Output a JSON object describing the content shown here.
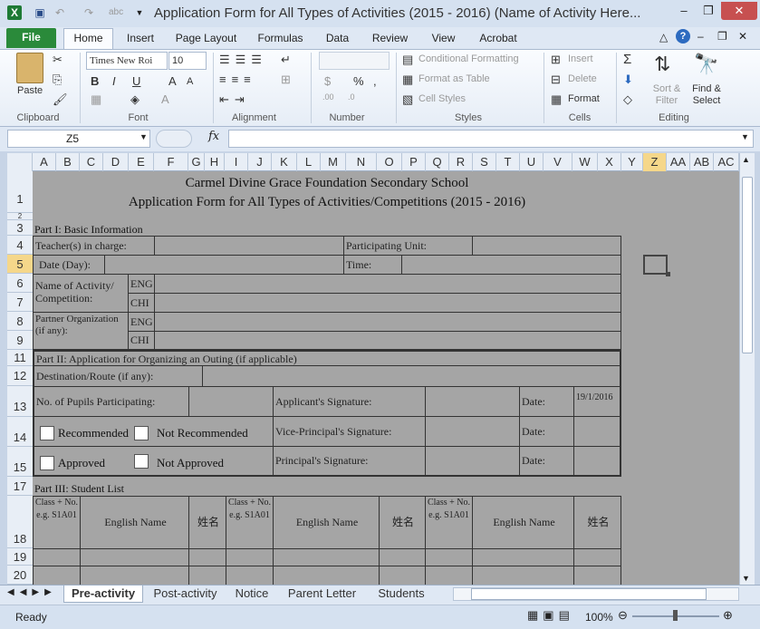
{
  "window": {
    "title": "Application Form for All Types of Activities (2015 - 2016) (Name of Activity Here...",
    "minimize": "–",
    "restore": "❐",
    "close": "✕"
  },
  "ribbon_tabs": [
    "File",
    "Home",
    "Insert",
    "Page Layout",
    "Formulas",
    "Data",
    "Review",
    "View",
    "Acrobat"
  ],
  "clipboard": {
    "paste": "Paste",
    "group": "Clipboard"
  },
  "font": {
    "name": "Times New Roi",
    "size": "10",
    "group": "Font",
    "bold": "B",
    "italic": "I",
    "underline": "U"
  },
  "alignment": {
    "group": "Alignment"
  },
  "number": {
    "group": "Number",
    "percent": "%",
    "comma": ","
  },
  "styles": {
    "conditional": "Conditional Formatting",
    "format_table": "Format as Table",
    "cell_styles": "Cell Styles",
    "group": "Styles"
  },
  "cells": {
    "insert": "Insert",
    "delete": "Delete",
    "format": "Format",
    "group": "Cells"
  },
  "editing": {
    "sort": "Sort & Filter",
    "find": "Find & Select",
    "group": "Editing",
    "sigma": "Σ"
  },
  "formula_bar": {
    "name_box": "Z5",
    "fx": "fx",
    "value": ""
  },
  "columns": [
    "A",
    "B",
    "C",
    "D",
    "E",
    "F",
    "G",
    "H",
    "I",
    "J",
    "K",
    "L",
    "M",
    "N",
    "O",
    "P",
    "Q",
    "R",
    "S",
    "T",
    "U",
    "V",
    "W",
    "X",
    "Y",
    "Z",
    "AA",
    "AB",
    "AC"
  ],
  "rows": [
    "1",
    "2",
    "3",
    "4",
    "5",
    "6",
    "7",
    "8",
    "9",
    "11",
    "12",
    "13",
    "14",
    "15",
    "17",
    "18",
    "19",
    "20"
  ],
  "form": {
    "school": "Carmel Divine Grace Foundation Secondary School",
    "title": "Application Form for All Types of Activities/Competitions (2015 - 2016)",
    "part1": "Part I: Basic Information",
    "teacher": "Teacher(s) in charge:",
    "unit": "Participating Unit:",
    "date_day": "Date (Day):",
    "time": "Time:",
    "activity_name": "Name of Activity/ Competition:",
    "eng": "ENG",
    "chi": "CHI",
    "partner": "Partner Organization (if any):",
    "part2": "Part II: Application for Organizing an Outing (if applicable)",
    "destination": "Destination/Route (if any):",
    "pupils": "No. of Pupils Participating:",
    "applicant_sig": "Applicant's Signature:",
    "date": "Date:",
    "date_value": "19/1/2016",
    "recommended": "Recommended",
    "not_recommended": "Not Recommended",
    "vp_sig": "Vice-Principal's Signature:",
    "approved": "Approved",
    "not_approved": "Not Approved",
    "principal_sig": "Principal's Signature:",
    "part3": "Part III: Student List",
    "class_hdr": "Class + No. e.g. S1A01",
    "english_name": "English Name",
    "chinese_name": "姓名"
  },
  "sheet_tabs": [
    "Pre-activity",
    "Post-activity",
    "Notice",
    "Parent Letter",
    "Students"
  ],
  "status": {
    "ready": "Ready",
    "zoom": "100%"
  }
}
